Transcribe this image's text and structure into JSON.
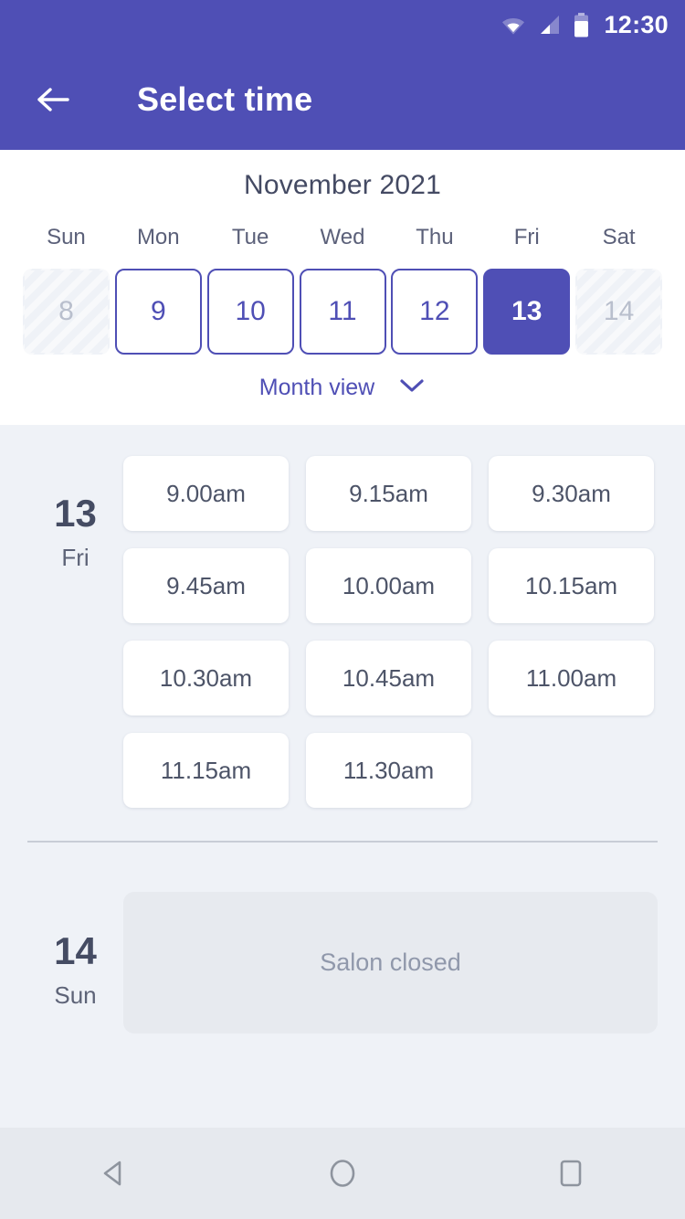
{
  "statusbar": {
    "time": "12:30",
    "icons": [
      "wifi-icon",
      "signal-icon",
      "battery-icon"
    ]
  },
  "appbar": {
    "title": "Select time",
    "back_icon": "back-arrow-icon"
  },
  "calendar": {
    "month_title": "November 2021",
    "weekday_headers": [
      "Sun",
      "Mon",
      "Tue",
      "Wed",
      "Thu",
      "Fri",
      "Sat"
    ],
    "days": [
      {
        "label": "8",
        "state": "disabled"
      },
      {
        "label": "9",
        "state": "normal"
      },
      {
        "label": "10",
        "state": "normal"
      },
      {
        "label": "11",
        "state": "normal"
      },
      {
        "label": "12",
        "state": "normal"
      },
      {
        "label": "13",
        "state": "selected"
      },
      {
        "label": "14",
        "state": "disabled"
      }
    ],
    "month_view_label": "Month view",
    "month_view_icon": "chevron-down-icon"
  },
  "schedule": [
    {
      "day_number": "13",
      "day_name": "Fri",
      "slots": [
        "9.00am",
        "9.15am",
        "9.30am",
        "9.45am",
        "10.00am",
        "10.15am",
        "10.30am",
        "10.45am",
        "11.00am",
        "11.15am",
        "11.30am"
      ],
      "closed_message": null
    },
    {
      "day_number": "14",
      "day_name": "Sun",
      "slots": [],
      "closed_message": "Salon closed"
    }
  ],
  "navbar": {
    "back": "nav-back-icon",
    "home": "nav-home-icon",
    "recents": "nav-recents-icon"
  },
  "colors": {
    "brand_purple": "#4f4fb5",
    "page_bg": "#eff2f7",
    "card_bg": "#ffffff",
    "closed_bg": "#e7eaef",
    "text_dark": "#454c63"
  }
}
